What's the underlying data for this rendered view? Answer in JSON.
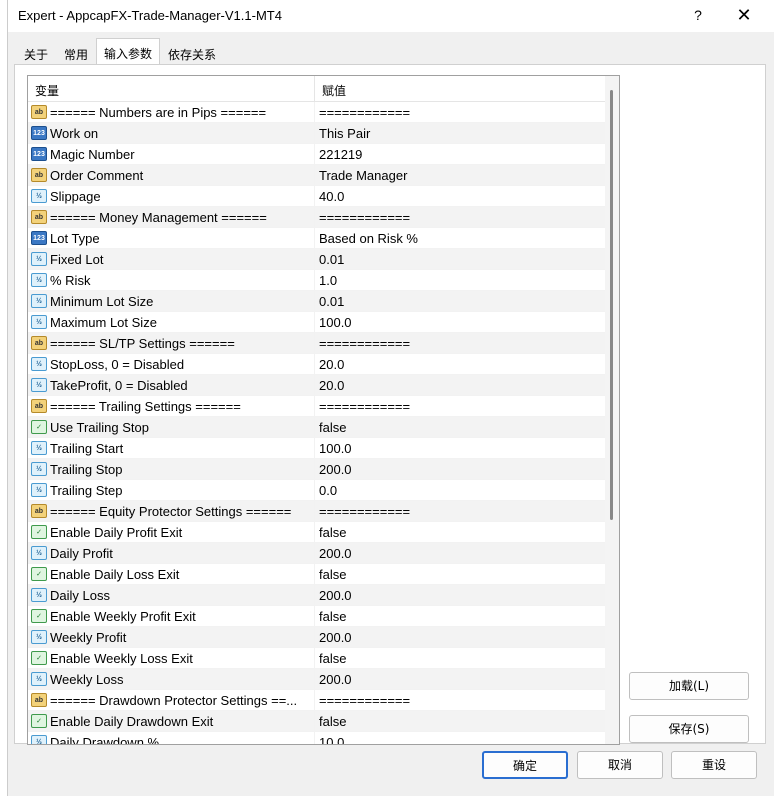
{
  "window": {
    "title": "Expert - AppcapFX-Trade-Manager-V1.1-MT4",
    "help": "?",
    "close": "✕"
  },
  "tabs": [
    "关于",
    "常用",
    "输入参数",
    "依存关系"
  ],
  "columns": {
    "variable": "变量",
    "value": "赋值"
  },
  "params": [
    {
      "icon": "ab",
      "name": "====== Numbers are in Pips ======",
      "value": "============"
    },
    {
      "icon": "123",
      "name": "Work on",
      "value": "This Pair"
    },
    {
      "icon": "123",
      "name": "Magic Number",
      "value": "221219"
    },
    {
      "icon": "ab",
      "name": "Order Comment",
      "value": "Trade Manager"
    },
    {
      "icon": "v12",
      "name": "Slippage",
      "value": "40.0"
    },
    {
      "icon": "ab",
      "name": "====== Money Management ======",
      "value": "============"
    },
    {
      "icon": "123",
      "name": "Lot Type",
      "value": "Based on Risk %"
    },
    {
      "icon": "v12",
      "name": "Fixed Lot",
      "value": "0.01"
    },
    {
      "icon": "v12",
      "name": "% Risk",
      "value": "1.0"
    },
    {
      "icon": "v12",
      "name": "Minimum Lot Size",
      "value": "0.01"
    },
    {
      "icon": "v12",
      "name": "Maximum Lot Size",
      "value": "100.0"
    },
    {
      "icon": "ab",
      "name": "====== SL/TP Settings ======",
      "value": "============"
    },
    {
      "icon": "v12",
      "name": "StopLoss, 0 = Disabled",
      "value": "20.0"
    },
    {
      "icon": "v12",
      "name": "TakeProfit, 0 = Disabled",
      "value": "20.0"
    },
    {
      "icon": "ab",
      "name": "====== Trailing Settings ======",
      "value": "============"
    },
    {
      "icon": "bool",
      "name": "Use Trailing Stop",
      "value": "false"
    },
    {
      "icon": "v12",
      "name": "Trailing Start",
      "value": "100.0"
    },
    {
      "icon": "v12",
      "name": "Trailing Stop",
      "value": "200.0"
    },
    {
      "icon": "v12",
      "name": "Trailing Step",
      "value": "0.0"
    },
    {
      "icon": "ab",
      "name": "====== Equity Protector Settings ======",
      "value": "============"
    },
    {
      "icon": "bool",
      "name": "Enable Daily Profit Exit",
      "value": "false"
    },
    {
      "icon": "v12",
      "name": "Daily Profit",
      "value": "200.0"
    },
    {
      "icon": "bool",
      "name": "Enable Daily Loss Exit",
      "value": "false"
    },
    {
      "icon": "v12",
      "name": "Daily Loss",
      "value": "200.0"
    },
    {
      "icon": "bool",
      "name": "Enable Weekly Profit Exit",
      "value": "false"
    },
    {
      "icon": "v12",
      "name": "Weekly Profit",
      "value": "200.0"
    },
    {
      "icon": "bool",
      "name": "Enable Weekly Loss Exit",
      "value": "false"
    },
    {
      "icon": "v12",
      "name": "Weekly Loss",
      "value": "200.0"
    },
    {
      "icon": "ab",
      "name": "====== Drawdown Protector Settings ==...",
      "value": "============"
    },
    {
      "icon": "bool",
      "name": "Enable Daily Drawdown Exit",
      "value": "false"
    },
    {
      "icon": "v12",
      "name": "Daily Drawdown %",
      "value": "10.0"
    }
  ],
  "icon_labels": {
    "ab": "ab",
    "123": "123",
    "v12": "½",
    "bool": "✓"
  },
  "buttons": {
    "load": "加载(L)",
    "save": "保存(S)",
    "ok": "确定",
    "cancel": "取消",
    "reset": "重设"
  }
}
